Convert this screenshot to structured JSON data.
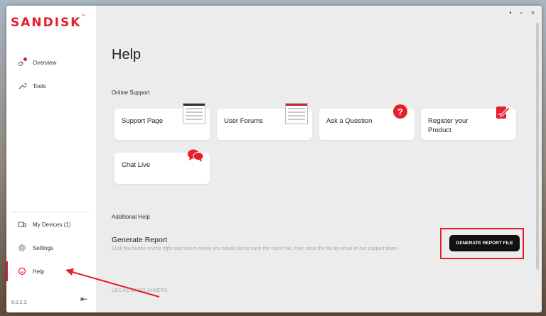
{
  "app": {
    "logo": "SANDISK",
    "logo_tm": "™",
    "version": "5.0.2.3"
  },
  "window_controls": {
    "minimize": "•",
    "maximize": "▫",
    "close": "×"
  },
  "sidebar": {
    "top_items": [
      {
        "label": "Overview",
        "icon": "overview-icon"
      },
      {
        "label": "Tools",
        "icon": "tools-icon"
      }
    ],
    "bottom_items": [
      {
        "label": "My Devices (1)",
        "icon": "devices-icon"
      },
      {
        "label": "Settings",
        "icon": "gear-icon"
      },
      {
        "label": "Help",
        "icon": "help-icon",
        "active": true
      }
    ],
    "collapse_label": "⇤"
  },
  "main": {
    "title": "Help",
    "online_support": {
      "heading": "Online Support",
      "cards": [
        {
          "label": "Support Page"
        },
        {
          "label": "User Forums"
        },
        {
          "label": "Ask a Question"
        },
        {
          "label": "Register your Product"
        },
        {
          "label": "Chat Live"
        }
      ]
    },
    "additional_help": {
      "heading": "Additional Help",
      "generate_report": {
        "title": "Generate Report",
        "description": "Click the button on the right and select where you would like to save the report file, then send the file by email to our support team.",
        "button_label": "GENERATE REPORT FILE"
      }
    },
    "legal_heading": "LEGAL DISCLAIMERS",
    "ask_badge": "?"
  },
  "colors": {
    "accent": "#e4202b",
    "button": "#111111"
  }
}
